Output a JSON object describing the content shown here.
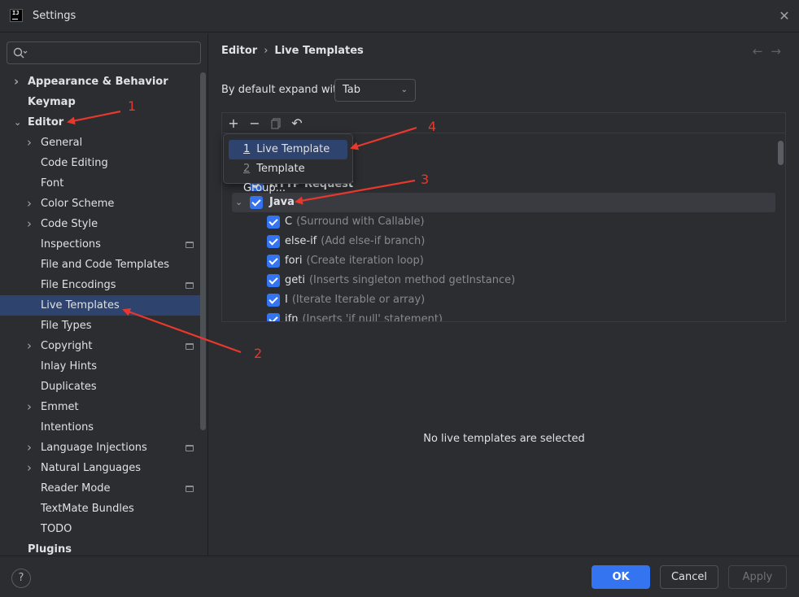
{
  "window": {
    "title": "Settings"
  },
  "sidebar": {
    "search_placeholder": "",
    "items": [
      {
        "label": "Appearance & Behavior",
        "level": 0,
        "bold": true,
        "chevron": "right",
        "project": false
      },
      {
        "label": "Keymap",
        "level": 0,
        "bold": true,
        "chevron": "none",
        "project": false
      },
      {
        "label": "Editor",
        "level": 0,
        "bold": true,
        "chevron": "down",
        "project": false
      },
      {
        "label": "General",
        "level": 1,
        "bold": false,
        "chevron": "right",
        "project": false
      },
      {
        "label": "Code Editing",
        "level": 1,
        "bold": false,
        "chevron": "none",
        "project": false
      },
      {
        "label": "Font",
        "level": 1,
        "bold": false,
        "chevron": "none",
        "project": false
      },
      {
        "label": "Color Scheme",
        "level": 1,
        "bold": false,
        "chevron": "right",
        "project": false
      },
      {
        "label": "Code Style",
        "level": 1,
        "bold": false,
        "chevron": "right",
        "project": false
      },
      {
        "label": "Inspections",
        "level": 1,
        "bold": false,
        "chevron": "none",
        "project": true
      },
      {
        "label": "File and Code Templates",
        "level": 1,
        "bold": false,
        "chevron": "none",
        "project": false
      },
      {
        "label": "File Encodings",
        "level": 1,
        "bold": false,
        "chevron": "none",
        "project": true
      },
      {
        "label": "Live Templates",
        "level": 1,
        "bold": false,
        "chevron": "none",
        "project": false,
        "selected": true
      },
      {
        "label": "File Types",
        "level": 1,
        "bold": false,
        "chevron": "none",
        "project": false
      },
      {
        "label": "Copyright",
        "level": 1,
        "bold": false,
        "chevron": "right",
        "project": true
      },
      {
        "label": "Inlay Hints",
        "level": 1,
        "bold": false,
        "chevron": "none",
        "project": false
      },
      {
        "label": "Duplicates",
        "level": 1,
        "bold": false,
        "chevron": "none",
        "project": false
      },
      {
        "label": "Emmet",
        "level": 1,
        "bold": false,
        "chevron": "right",
        "project": false
      },
      {
        "label": "Intentions",
        "level": 1,
        "bold": false,
        "chevron": "none",
        "project": false
      },
      {
        "label": "Language Injections",
        "level": 1,
        "bold": false,
        "chevron": "right",
        "project": true
      },
      {
        "label": "Natural Languages",
        "level": 1,
        "bold": false,
        "chevron": "right",
        "project": false
      },
      {
        "label": "Reader Mode",
        "level": 1,
        "bold": false,
        "chevron": "none",
        "project": true
      },
      {
        "label": "TextMate Bundles",
        "level": 1,
        "bold": false,
        "chevron": "none",
        "project": false
      },
      {
        "label": "TODO",
        "level": 1,
        "bold": false,
        "chevron": "none",
        "project": false
      },
      {
        "label": "Plugins",
        "level": 0,
        "bold": true,
        "chevron": "none",
        "project": false
      }
    ]
  },
  "breadcrumb": {
    "parent": "Editor",
    "current": "Live Templates"
  },
  "expand": {
    "label": "By default expand with",
    "value": "Tab"
  },
  "toolbar": {
    "add": "+",
    "remove": "−",
    "undo": "↶"
  },
  "popup": {
    "items": [
      {
        "mnemonic": "1",
        "label": "Live Template"
      },
      {
        "mnemonic": "2",
        "label": "Template Group..."
      }
    ]
  },
  "template_list": {
    "partial_group": "HTTP Request",
    "group": "Java",
    "templates": [
      {
        "abbr": "C",
        "desc": "(Surround with Callable)"
      },
      {
        "abbr": "else-if",
        "desc": "(Add else-if branch)"
      },
      {
        "abbr": "fori",
        "desc": "(Create iteration loop)"
      },
      {
        "abbr": "geti",
        "desc": "(Inserts singleton method getInstance)"
      },
      {
        "abbr": "I",
        "desc": "(Iterate Iterable or array)"
      },
      {
        "abbr": "ifn",
        "desc": "(Inserts 'if null' statement)"
      }
    ]
  },
  "detail": {
    "empty_message": "No live templates are selected"
  },
  "footer": {
    "help": "?",
    "ok": "OK",
    "cancel": "Cancel",
    "apply": "Apply"
  },
  "annotations": {
    "numbers": [
      "1",
      "2",
      "3",
      "4"
    ],
    "color": "#e8382d"
  },
  "colors": {
    "accent": "#3574f0",
    "selection": "#2e436e",
    "background": "#2b2d30"
  }
}
